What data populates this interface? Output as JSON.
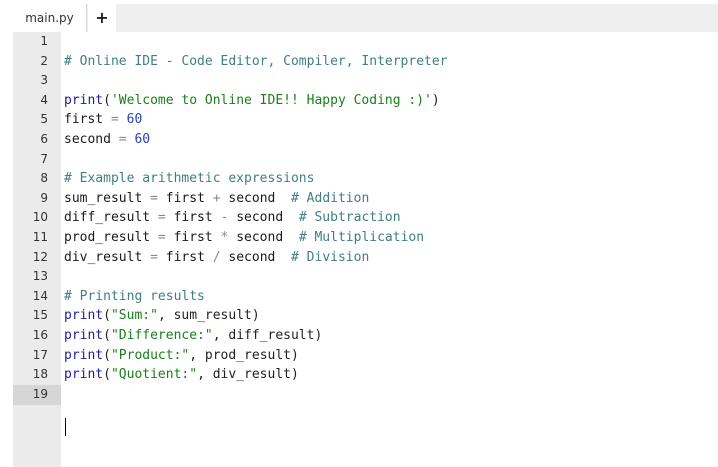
{
  "tabs": [
    {
      "label": "main.py"
    }
  ],
  "add_tab_label": "+",
  "editor": {
    "active_line": 19,
    "lines": [
      {
        "n": "1",
        "tokens": []
      },
      {
        "n": "2",
        "tokens": [
          {
            "t": "# Online IDE - Code Editor, Compiler, Interpreter",
            "k": "comment"
          }
        ]
      },
      {
        "n": "3",
        "tokens": []
      },
      {
        "n": "4",
        "tokens": [
          {
            "t": "print",
            "k": "func"
          },
          {
            "t": "(",
            "k": "punc"
          },
          {
            "t": "'Welcome to Online IDE!! Happy Coding :)'",
            "k": "str"
          },
          {
            "t": ")",
            "k": "punc"
          }
        ]
      },
      {
        "n": "5",
        "tokens": [
          {
            "t": "first",
            "k": "var"
          },
          {
            "t": " = ",
            "k": "op"
          },
          {
            "t": "60",
            "k": "num"
          }
        ]
      },
      {
        "n": "6",
        "tokens": [
          {
            "t": "second",
            "k": "var"
          },
          {
            "t": " = ",
            "k": "op"
          },
          {
            "t": "60",
            "k": "num"
          }
        ]
      },
      {
        "n": "7",
        "tokens": []
      },
      {
        "n": "8",
        "tokens": [
          {
            "t": "# Example arithmetic expressions",
            "k": "comment"
          }
        ]
      },
      {
        "n": "9",
        "tokens": [
          {
            "t": "sum_result",
            "k": "var"
          },
          {
            "t": " = ",
            "k": "op"
          },
          {
            "t": "first",
            "k": "var"
          },
          {
            "t": " + ",
            "k": "op"
          },
          {
            "t": "second",
            "k": "var"
          },
          {
            "t": "  ",
            "k": "punc"
          },
          {
            "t": "# Addition",
            "k": "comment"
          }
        ]
      },
      {
        "n": "10",
        "tokens": [
          {
            "t": "diff_result",
            "k": "var"
          },
          {
            "t": " = ",
            "k": "op"
          },
          {
            "t": "first",
            "k": "var"
          },
          {
            "t": " - ",
            "k": "op"
          },
          {
            "t": "second",
            "k": "var"
          },
          {
            "t": "  ",
            "k": "punc"
          },
          {
            "t": "# Subtraction",
            "k": "comment"
          }
        ]
      },
      {
        "n": "11",
        "tokens": [
          {
            "t": "prod_result",
            "k": "var"
          },
          {
            "t": " = ",
            "k": "op"
          },
          {
            "t": "first",
            "k": "var"
          },
          {
            "t": " * ",
            "k": "op"
          },
          {
            "t": "second",
            "k": "var"
          },
          {
            "t": "  ",
            "k": "punc"
          },
          {
            "t": "# Multiplication",
            "k": "comment"
          }
        ]
      },
      {
        "n": "12",
        "tokens": [
          {
            "t": "div_result",
            "k": "var"
          },
          {
            "t": " = ",
            "k": "op"
          },
          {
            "t": "first",
            "k": "var"
          },
          {
            "t": " / ",
            "k": "op"
          },
          {
            "t": "second",
            "k": "var"
          },
          {
            "t": "  ",
            "k": "punc"
          },
          {
            "t": "# Division",
            "k": "comment"
          }
        ]
      },
      {
        "n": "13",
        "tokens": []
      },
      {
        "n": "14",
        "tokens": [
          {
            "t": "# Printing results",
            "k": "comment"
          }
        ]
      },
      {
        "n": "15",
        "tokens": [
          {
            "t": "print",
            "k": "func"
          },
          {
            "t": "(",
            "k": "punc"
          },
          {
            "t": "\"Sum:\"",
            "k": "str"
          },
          {
            "t": ", sum_result)",
            "k": "punc"
          }
        ]
      },
      {
        "n": "16",
        "tokens": [
          {
            "t": "print",
            "k": "func"
          },
          {
            "t": "(",
            "k": "punc"
          },
          {
            "t": "\"Difference:\"",
            "k": "str"
          },
          {
            "t": ", diff_result)",
            "k": "punc"
          }
        ]
      },
      {
        "n": "17",
        "tokens": [
          {
            "t": "print",
            "k": "func"
          },
          {
            "t": "(",
            "k": "punc"
          },
          {
            "t": "\"Product:\"",
            "k": "str"
          },
          {
            "t": ", prod_result)",
            "k": "punc"
          }
        ]
      },
      {
        "n": "18",
        "tokens": [
          {
            "t": "print",
            "k": "func"
          },
          {
            "t": "(",
            "k": "punc"
          },
          {
            "t": "\"Quotient:\"",
            "k": "str"
          },
          {
            "t": ", div_result)",
            "k": "punc"
          }
        ]
      },
      {
        "n": "19",
        "tokens": []
      }
    ]
  }
}
